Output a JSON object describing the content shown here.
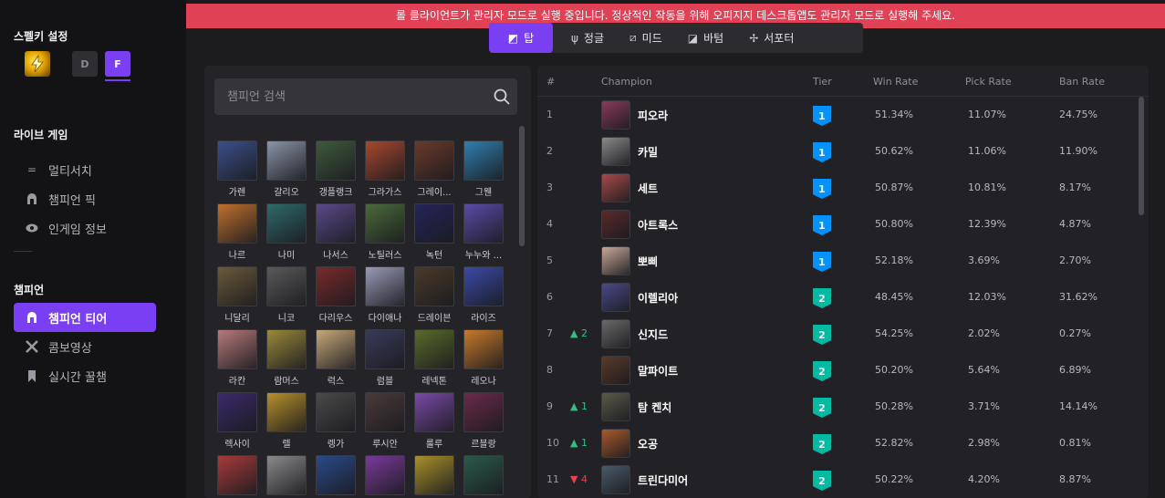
{
  "banner": "롤 클라이언트가 관리자 모드로 실행 중입니다. 정상적인 작동을 위해 오피지지 데스크톱앱도 관리자 모드로 실행해 주세요.",
  "sidebar": {
    "spell_heading": "스펠키 설정",
    "spell_keys": [
      "D",
      "F"
    ],
    "live_heading": "라이브 게임",
    "live_items": [
      {
        "label": "멀티서치",
        "icon": "list-icon"
      },
      {
        "label": "챔피언 픽",
        "icon": "helmet-icon"
      },
      {
        "label": "인게임 정보",
        "icon": "eye-icon"
      }
    ],
    "champ_heading": "챔피언",
    "champ_items": [
      {
        "label": "챔피언 티어",
        "icon": "helmet-icon",
        "active": true
      },
      {
        "label": "콤보영상",
        "icon": "crossed-swords-icon"
      },
      {
        "label": "실시간 꿀챔",
        "icon": "bookmark-icon"
      }
    ]
  },
  "tabs": [
    {
      "label": "탑",
      "icon": "top-lane-icon",
      "active": true
    },
    {
      "label": "정글",
      "icon": "jungle-icon"
    },
    {
      "label": "미드",
      "icon": "mid-lane-icon"
    },
    {
      "label": "바텀",
      "icon": "bottom-lane-icon"
    },
    {
      "label": "서포터",
      "icon": "support-icon"
    }
  ],
  "search": {
    "placeholder": "챔피언 검색"
  },
  "champions": [
    {
      "name": "가렌",
      "color": "#3b4f8a"
    },
    {
      "name": "갈리오",
      "color": "#8a95a8"
    },
    {
      "name": "갱플랭크",
      "color": "#3e5a3c"
    },
    {
      "name": "그라가스",
      "color": "#a8482e"
    },
    {
      "name": "그레이...",
      "color": "#6a3a2a"
    },
    {
      "name": "그웬",
      "color": "#2f7fb0"
    },
    {
      "name": "나르",
      "color": "#c0702e"
    },
    {
      "name": "나미",
      "color": "#2e6a6a"
    },
    {
      "name": "나서스",
      "color": "#5a4a8a"
    },
    {
      "name": "노틸러스",
      "color": "#4a6a3a"
    },
    {
      "name": "녹턴",
      "color": "#24245a"
    },
    {
      "name": "누누와 ...",
      "color": "#5a4aa8"
    },
    {
      "name": "니달리",
      "color": "#6a5a3a"
    },
    {
      "name": "니코",
      "color": "#5a5a5a"
    },
    {
      "name": "다리우스",
      "color": "#7a2a2a"
    },
    {
      "name": "다이애나",
      "color": "#9a9ab8"
    },
    {
      "name": "드레이븐",
      "color": "#4a3a2a"
    },
    {
      "name": "라이즈",
      "color": "#3a4aa8"
    },
    {
      "name": "라칸",
      "color": "#b87a7a"
    },
    {
      "name": "람머스",
      "color": "#9a8a3a"
    },
    {
      "name": "럭스",
      "color": "#c8a87a"
    },
    {
      "name": "럼블",
      "color": "#3a3a5a"
    },
    {
      "name": "레넥톤",
      "color": "#5a6a2a"
    },
    {
      "name": "레오나",
      "color": "#c87a2a"
    },
    {
      "name": "렉사이",
      "color": "#3a2a6a"
    },
    {
      "name": "렐",
      "color": "#b8902a"
    },
    {
      "name": "렝가",
      "color": "#4a4a4a"
    },
    {
      "name": "루시안",
      "color": "#4a3a3a"
    },
    {
      "name": "룰루",
      "color": "#7a4aa8"
    },
    {
      "name": "르블랑",
      "color": "#6a2a4a"
    },
    {
      "name": "",
      "color": "#a83a3a"
    },
    {
      "name": "",
      "color": "#8a8a8a"
    },
    {
      "name": "",
      "color": "#2a4a8a"
    },
    {
      "name": "",
      "color": "#7a3a9a"
    },
    {
      "name": "",
      "color": "#a8902a"
    },
    {
      "name": "",
      "color": "#2a5a4a"
    }
  ],
  "tier_table": {
    "headers": [
      "#",
      "Champion",
      "Tier",
      "Win Rate",
      "Pick Rate",
      "Ban Rate"
    ],
    "rows": [
      {
        "rank": "1",
        "change": "",
        "dir": "",
        "name": "피오라",
        "tier": "1",
        "win": "51.34%",
        "pick": "11.07%",
        "ban": "24.75%",
        "color": "#8a3a5a"
      },
      {
        "rank": "2",
        "change": "",
        "dir": "",
        "name": "카밀",
        "tier": "1",
        "win": "50.62%",
        "pick": "11.06%",
        "ban": "11.90%",
        "color": "#8a8a8a"
      },
      {
        "rank": "3",
        "change": "",
        "dir": "",
        "name": "세트",
        "tier": "1",
        "win": "50.87%",
        "pick": "10.81%",
        "ban": "8.17%",
        "color": "#a84a4a"
      },
      {
        "rank": "4",
        "change": "",
        "dir": "",
        "name": "아트록스",
        "tier": "1",
        "win": "50.80%",
        "pick": "12.39%",
        "ban": "4.87%",
        "color": "#5a2a2a"
      },
      {
        "rank": "5",
        "change": "",
        "dir": "",
        "name": "뽀삐",
        "tier": "1",
        "win": "52.18%",
        "pick": "3.69%",
        "ban": "2.70%",
        "color": "#c8a89a"
      },
      {
        "rank": "6",
        "change": "",
        "dir": "",
        "name": "이렐리아",
        "tier": "2",
        "win": "48.45%",
        "pick": "12.03%",
        "ban": "31.62%",
        "color": "#4a4a8a"
      },
      {
        "rank": "7",
        "change": "▲ 2",
        "dir": "up",
        "name": "신지드",
        "tier": "2",
        "win": "54.25%",
        "pick": "2.02%",
        "ban": "0.27%",
        "color": "#6a6a6a"
      },
      {
        "rank": "8",
        "change": "",
        "dir": "",
        "name": "말파이트",
        "tier": "2",
        "win": "50.20%",
        "pick": "5.64%",
        "ban": "6.89%",
        "color": "#5a3a2a"
      },
      {
        "rank": "9",
        "change": "▲ 1",
        "dir": "up",
        "name": "탐 켄치",
        "tier": "2",
        "win": "50.28%",
        "pick": "3.71%",
        "ban": "14.14%",
        "color": "#5a5a4a"
      },
      {
        "rank": "10",
        "change": "▲ 1",
        "dir": "up",
        "name": "오공",
        "tier": "2",
        "win": "52.82%",
        "pick": "2.98%",
        "ban": "0.81%",
        "color": "#a85a2a"
      },
      {
        "rank": "11",
        "change": "▼ 4",
        "dir": "down",
        "name": "트린다미어",
        "tier": "2",
        "win": "50.22%",
        "pick": "4.20%",
        "ban": "8.87%",
        "color": "#4a5a6a"
      }
    ]
  }
}
